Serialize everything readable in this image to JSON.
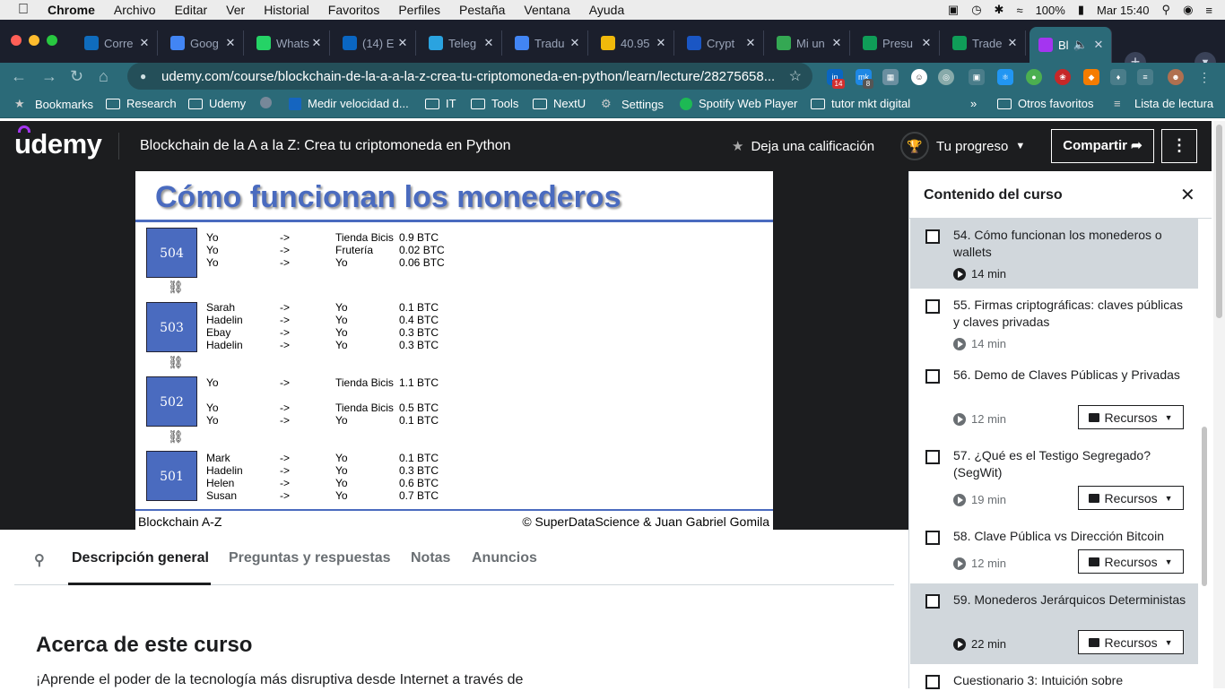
{
  "menubar": {
    "app": "Chrome",
    "items": [
      "Archivo",
      "Editar",
      "Ver",
      "Historial",
      "Favoritos",
      "Perfiles",
      "Pestaña",
      "Ventana",
      "Ayuda"
    ],
    "battery": "100%",
    "clock": "Mar 15:40"
  },
  "tabs": [
    {
      "title": "Corre",
      "favicon": "outlook-icon",
      "color": "#0f6cbd"
    },
    {
      "title": "Goog",
      "favicon": "calendar-icon",
      "color": "#4285f4"
    },
    {
      "title": "Whats",
      "favicon": "whatsapp-icon",
      "color": "#25d366"
    },
    {
      "title": "(14) E",
      "favicon": "linkedin-icon",
      "color": "#0a66c2"
    },
    {
      "title": "Teleg",
      "favicon": "telegram-icon",
      "color": "#2aa3e0"
    },
    {
      "title": "Tradu",
      "favicon": "translate-icon",
      "color": "#4285f4"
    },
    {
      "title": "40.95",
      "favicon": "binance-icon",
      "color": "#f0b90b"
    },
    {
      "title": "Crypt",
      "favicon": "info-icon",
      "color": "#1a56c4"
    },
    {
      "title": "Mi un",
      "favicon": "drive-icon",
      "color": "#34a853"
    },
    {
      "title": "Presu",
      "favicon": "sheets-icon",
      "color": "#0f9d58"
    },
    {
      "title": "Trade",
      "favicon": "sheets-icon",
      "color": "#0f9d58"
    },
    {
      "title": "Bl",
      "favicon": "udemy-icon",
      "color": "#a435f0"
    }
  ],
  "url": "udemy.com/course/blockchain-de-la-a-a-la-z-crea-tu-criptomoneda-en-python/learn/lecture/28275658...",
  "extension_badges": {
    "linkedin": "14",
    "mk": "8"
  },
  "bookmarks": [
    "Bookmarks",
    "Research",
    "Udemy",
    "",
    "Medir velocidad d...",
    "IT",
    "Tools",
    "NextU",
    "Settings",
    "Spotify Web Player",
    "tutor mkt digital"
  ],
  "bookmarks_overflow": "»",
  "bookmarks_right": [
    "Otros favoritos",
    "Lista de lectura"
  ],
  "header": {
    "logo": "udemy",
    "course_title": "Blockchain de la A a la Z: Crea tu criptomoneda en Python",
    "rate": "Deja una calificación",
    "progress": "Tu progreso",
    "share": "Compartir"
  },
  "slide": {
    "title": "Cómo funcionan los monederos",
    "blocks": [
      {
        "id": "504",
        "tx": [
          [
            "Yo",
            "->",
            "Tienda Bicis",
            "0.9 BTC"
          ],
          [
            "Yo",
            "->",
            "Frutería",
            "0.02 BTC"
          ],
          [
            "Yo",
            "->",
            "Yo",
            "0.06 BTC"
          ]
        ]
      },
      {
        "id": "503",
        "tx": [
          [
            "Sarah",
            "->",
            "Yo",
            "0.1 BTC"
          ],
          [
            "Hadelin",
            "->",
            "Yo",
            "0.4 BTC"
          ],
          [
            "Ebay",
            "->",
            "Yo",
            "0.3 BTC"
          ],
          [
            "Hadelin",
            "->",
            "Yo",
            "0.3 BTC"
          ]
        ]
      },
      {
        "id": "502",
        "tx": [
          [
            "Yo",
            "->",
            "Tienda Bicis",
            "1.1 BTC"
          ],
          [
            "",
            "",
            "",
            ""
          ],
          [
            "Yo",
            "->",
            "Tienda Bicis",
            "0.5 BTC"
          ],
          [
            "Yo",
            "->",
            "Yo",
            "0.1 BTC"
          ]
        ]
      },
      {
        "id": "501",
        "tx": [
          [
            "Mark",
            "->",
            "Yo",
            "0.1 BTC"
          ],
          [
            "Hadelin",
            "->",
            "Yo",
            "0.3 BTC"
          ],
          [
            "Helen",
            "->",
            "Yo",
            "0.6 BTC"
          ],
          [
            "Susan",
            "->",
            "Yo",
            "0.7 BTC"
          ]
        ]
      }
    ],
    "footer_left": "Blockchain A-Z",
    "footer_right": "© SuperDataScience & Juan Gabriel Gomila"
  },
  "content_tabs": [
    "Descripción general",
    "Preguntas y respuestas",
    "Notas",
    "Anuncios"
  ],
  "about": {
    "title": "Acerca de este curso",
    "text": "¡Aprende el poder de la tecnología más disruptiva desde Internet a través de"
  },
  "sidebar": {
    "title": "Contenido del curso",
    "items": [
      {
        "title": "54. Cómo funcionan los monederos o wallets",
        "duration": "14 min",
        "resources": false,
        "selected": true
      },
      {
        "title": "55. Firmas criptográficas: claves públicas y claves privadas",
        "duration": "14 min",
        "resources": false,
        "selected": false
      },
      {
        "title": "56. Demo de Claves Públicas y Privadas",
        "duration": "12 min",
        "resources": true,
        "selected": false
      },
      {
        "title": "57. ¿Qué es el Testigo Segregado? (SegWit)",
        "duration": "19 min",
        "resources": true,
        "selected": false
      },
      {
        "title": "58. Clave Pública vs Dirección Bitcoin",
        "duration": "12 min",
        "resources": true,
        "selected": false
      },
      {
        "title": "59. Monederos Jerárquicos Deterministas",
        "duration": "22 min",
        "resources": true,
        "selected": true
      },
      {
        "title": "Cuestionario 3: Intuición sobre",
        "duration": "",
        "resources": false,
        "selected": false
      }
    ],
    "resources_label": "Recursos"
  }
}
